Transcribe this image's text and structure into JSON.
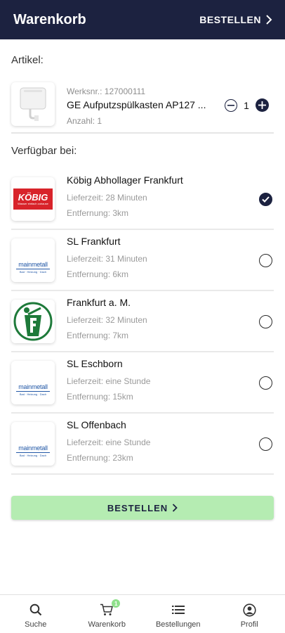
{
  "header": {
    "title": "Warenkorb",
    "order_label": "BESTELLEN"
  },
  "article_section_label": "Artikel:",
  "article": {
    "werksnr": "Werksnr.: 127000111",
    "name": "GE Aufputzspülkasten AP127 ...",
    "anzahl": "Anzahl: 1",
    "quantity": "1",
    "image_icon": "toilet-cistern-image"
  },
  "available_section_label": "Verfügbar bei:",
  "stores": [
    {
      "name": "Köbig Abhollager Frankfurt",
      "lieferzeit": "Lieferzeit: 28 Minuten",
      "entfernung": "Entfernung: 3km",
      "selected": true,
      "logo": "koebig-logo",
      "logo_text": "KÖBIG",
      "logo_subtext": "Wasser einfach zuhause"
    },
    {
      "name": "SL Frankfurt",
      "lieferzeit": "Lieferzeit: 31 Minuten",
      "entfernung": "Entfernung: 6km",
      "selected": false,
      "logo": "mainmetall-logo",
      "logo_text": "mainmetall",
      "logo_subtext": "Bad · Heizung · Dach"
    },
    {
      "name": "Frankfurt a. M.",
      "lieferzeit": "Lieferzeit: 32 Minuten",
      "entfernung": "Entfernung: 7km",
      "selected": false,
      "logo": "green-f-logo"
    },
    {
      "name": "SL Eschborn",
      "lieferzeit": "Lieferzeit: eine Stunde",
      "entfernung": "Entfernung: 15km",
      "selected": false,
      "logo": "mainmetall-logo",
      "logo_text": "mainmetall",
      "logo_subtext": "Bad · Heizung · Dach"
    },
    {
      "name": "SL Offenbach",
      "lieferzeit": "Lieferzeit: eine Stunde",
      "entfernung": "Entfernung: 23km",
      "selected": false,
      "logo": "mainmetall-logo",
      "logo_text": "mainmetall",
      "logo_subtext": "Bad · Heizung · Dach"
    }
  ],
  "order_button_label": "BESTELLEN",
  "bottom_nav": [
    {
      "label": "Suche",
      "icon": "search-icon"
    },
    {
      "label": "Warenkorb",
      "icon": "cart-icon",
      "badge": "1"
    },
    {
      "label": "Bestellungen",
      "icon": "list-icon"
    },
    {
      "label": "Profil",
      "icon": "profile-icon"
    }
  ],
  "colors": {
    "header_bg": "#1c2240",
    "order_button_bg": "#b5ecb2",
    "badge": "#8fe08b",
    "koebig_red": "#d8232a",
    "mainmetall_blue": "#2157a6",
    "green_logo": "#1e7a3a"
  }
}
